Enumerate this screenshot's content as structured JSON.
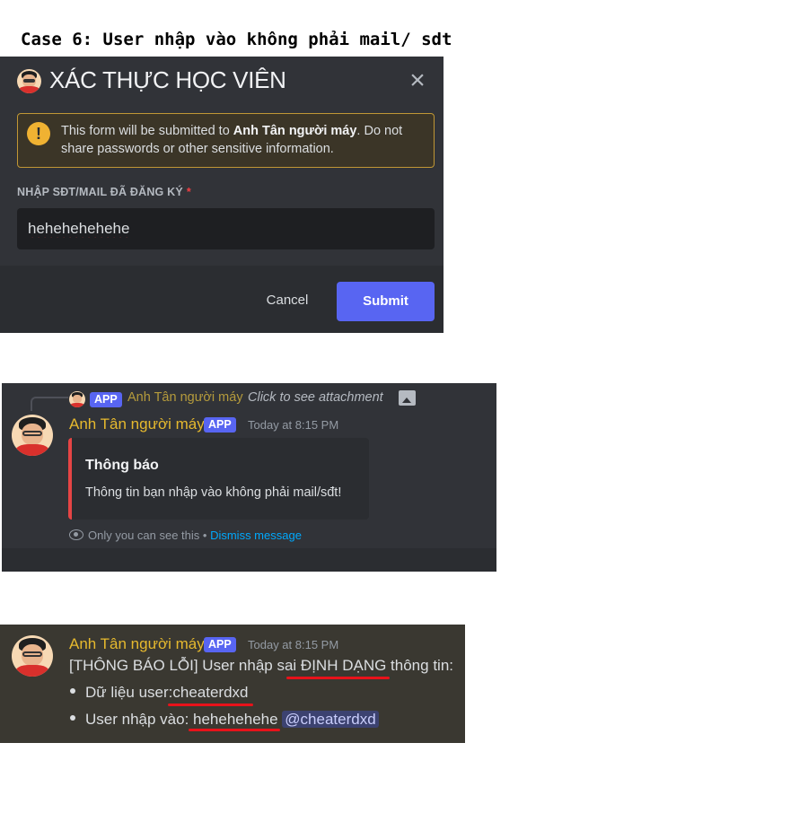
{
  "case_title": "Case 6: User nhập vào không phải mail/ sdt",
  "modal": {
    "title": "XÁC THỰC HỌC VIÊN",
    "close_symbol": "×",
    "warning_icon_symbol": "!",
    "warning_prefix": "This form will be submitted to ",
    "warning_bot": "Anh Tân người máy",
    "warning_suffix": ". Do not share passwords or other sensitive information.",
    "field_label": "NHẬP SĐT/MAIL ĐÃ ĐĂNG KÝ",
    "required_mark": "*",
    "field_value": "hehehehehehe",
    "cancel_label": "Cancel",
    "submit_label": "Submit"
  },
  "ephemeral": {
    "reply_badge": "APP",
    "reply_name": "Anh Tân người máy",
    "reply_text": "Click to see attachment",
    "author": "Anh Tân người máy",
    "badge": "APP",
    "time": "Today at 8:15 PM",
    "embed_title": "Thông báo",
    "embed_desc": "Thông tin bạn nhập vào không phải mail/sđt!",
    "only_you": "Only you can see this",
    "separator": " • ",
    "dismiss": "Dismiss message",
    "accent_color": "#e64545"
  },
  "error_log": {
    "author": "Anh Tân người máy",
    "badge": "APP",
    "time": "Today at 8:15 PM",
    "line_prefix": "[THÔNG BÁO LỖI] User nhập sai ",
    "line_highlight": "ĐỊNH DẠNG",
    "line_suffix": " thông tin:",
    "bullet1_label": "Dữ liệu user:",
    "bullet1_value": "cheaterdxd",
    "bullet2_label": "User nhập vào: ",
    "bullet2_value": "hehehehehe",
    "mention": "@cheaterdxd"
  },
  "colors": {
    "bot_name": "#e6b92e",
    "blurple": "#5865f2",
    "underline_red": "#e8121a"
  }
}
